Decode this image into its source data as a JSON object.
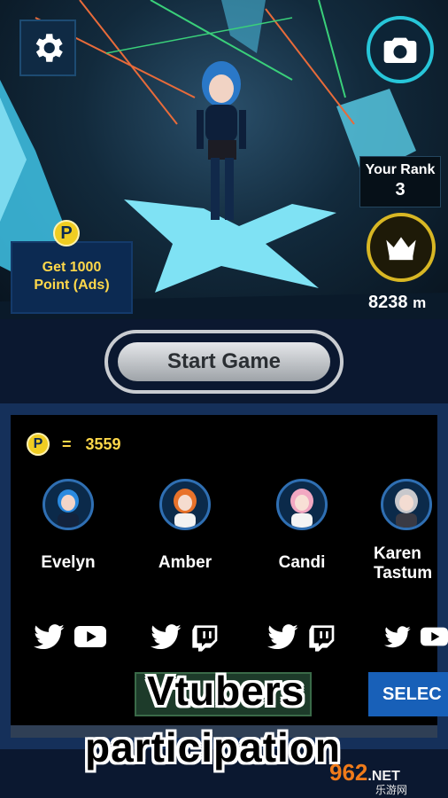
{
  "scene": {
    "settings_icon": "gear-icon",
    "camera_icon": "camera-icon",
    "crown_icon": "crown-icon"
  },
  "rank": {
    "title": "Your Rank",
    "value": "3"
  },
  "distance": {
    "value": "8238",
    "unit": "m"
  },
  "ads": {
    "badge": "P",
    "label_line1": "Get 1000",
    "label_line2": "Point (Ads)"
  },
  "start_button": {
    "label": "Start Game"
  },
  "points": {
    "badge": "P",
    "equals": "=",
    "value": "3559"
  },
  "characters": [
    {
      "name": "Evelyn",
      "name2": "",
      "socials": [
        "twitter-icon",
        "youtube-icon"
      ]
    },
    {
      "name": "Amber",
      "name2": "",
      "socials": [
        "twitter-icon",
        "twitch-icon"
      ]
    },
    {
      "name": "Candi",
      "name2": "",
      "socials": [
        "twitter-icon",
        "twitch-icon"
      ]
    },
    {
      "name": "Karen",
      "name2": "Tastum",
      "socials": [
        "twitter-icon",
        "youtube-icon"
      ]
    }
  ],
  "select_button": {
    "label": "SELEC"
  },
  "overlay": {
    "line1": "Vtubers",
    "line2": "participation"
  },
  "watermark": {
    "logo": "962",
    "suffix": ".NET",
    "sub": "乐游网"
  },
  "colors": {
    "accent_cyan": "#27c6d9",
    "gold": "#d8b724",
    "points_yellow": "#ffd84a",
    "panel_blue": "#15305a"
  }
}
